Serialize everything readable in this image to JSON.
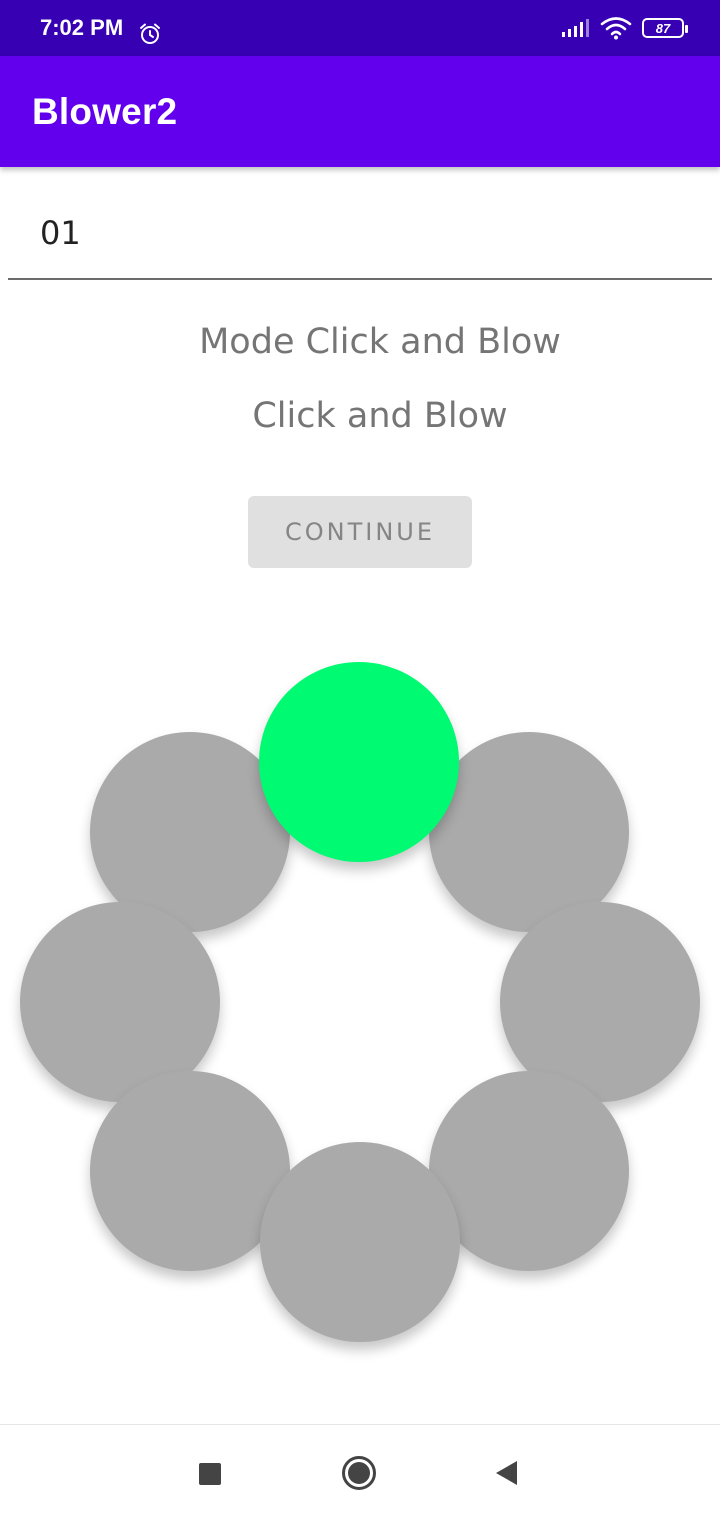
{
  "status_bar": {
    "time": "7:02 PM",
    "battery_level": "87",
    "icons": [
      "alarm-icon",
      "signal-icon",
      "wifi-icon",
      "battery-icon"
    ]
  },
  "app_bar": {
    "title": "Blower2"
  },
  "number_field": {
    "value": "01"
  },
  "mode_label": "Mode Click and Blow",
  "instruction_label": "Click and Blow",
  "continue_button": {
    "label": "CONTINUE"
  },
  "circles": [
    {
      "name": "circle-top",
      "active": true
    },
    {
      "name": "circle-top-right",
      "active": false
    },
    {
      "name": "circle-right",
      "active": false
    },
    {
      "name": "circle-bottom-right",
      "active": false
    },
    {
      "name": "circle-bottom",
      "active": false
    },
    {
      "name": "circle-bottom-left",
      "active": false
    },
    {
      "name": "circle-left",
      "active": false
    },
    {
      "name": "circle-top-left",
      "active": false
    }
  ],
  "colors": {
    "status_bar": "#3700b3",
    "app_bar": "#6200ee",
    "active_circle": "#00fa72",
    "inactive_circle": "#aaaaaa"
  },
  "nav_bar": {
    "icons": [
      "recents-icon",
      "home-icon",
      "back-icon"
    ]
  }
}
